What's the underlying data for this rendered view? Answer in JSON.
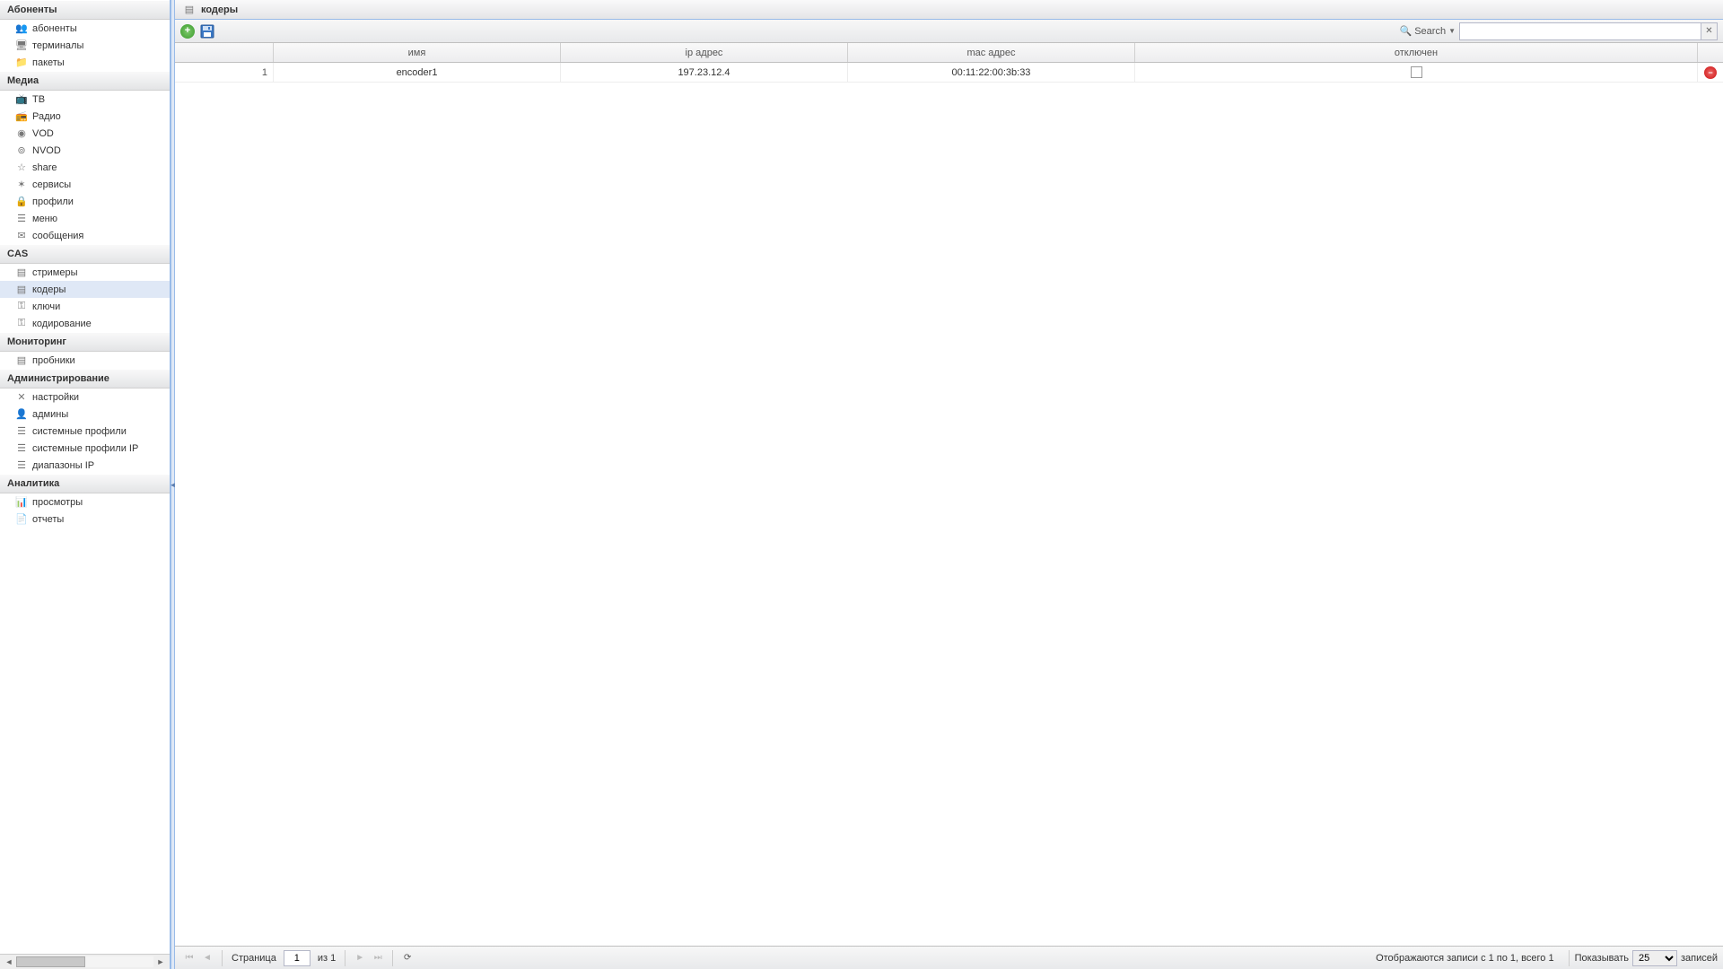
{
  "sidebar": {
    "groups": [
      {
        "title": "Абоненты",
        "items": [
          {
            "label": "абоненты",
            "icon": "👥"
          },
          {
            "label": "терминалы",
            "icon": "🖥"
          },
          {
            "label": "пакеты",
            "icon": "📁"
          }
        ]
      },
      {
        "title": "Медиа",
        "items": [
          {
            "label": "ТВ",
            "icon": "📺"
          },
          {
            "label": "Радио",
            "icon": "📻"
          },
          {
            "label": "VOD",
            "icon": "◉"
          },
          {
            "label": "NVOD",
            "icon": "⊚"
          },
          {
            "label": "share",
            "icon": "☆"
          },
          {
            "label": "сервисы",
            "icon": "✶"
          },
          {
            "label": "профили",
            "icon": "🔒"
          },
          {
            "label": "меню",
            "icon": "☰"
          },
          {
            "label": "сообщения",
            "icon": "✉"
          }
        ]
      },
      {
        "title": "CAS",
        "items": [
          {
            "label": "стримеры",
            "icon": "▤"
          },
          {
            "label": "кодеры",
            "icon": "▤",
            "selected": true
          },
          {
            "label": "ключи",
            "icon": "⚿"
          },
          {
            "label": "кодирование",
            "icon": "⚿"
          }
        ]
      },
      {
        "title": "Мониторинг",
        "items": [
          {
            "label": "пробники",
            "icon": "▤"
          }
        ]
      },
      {
        "title": "Администрирование",
        "items": [
          {
            "label": "настройки",
            "icon": "✕"
          },
          {
            "label": "админы",
            "icon": "👤"
          },
          {
            "label": "системные профили",
            "icon": "☰"
          },
          {
            "label": "системные профили IP",
            "icon": "☰"
          },
          {
            "label": "диапазоны IP",
            "icon": "☰"
          }
        ]
      },
      {
        "title": "Аналитика",
        "items": [
          {
            "label": "просмотры",
            "icon": "📊"
          },
          {
            "label": "отчеты",
            "icon": "📄"
          }
        ]
      }
    ]
  },
  "panel": {
    "title": "кодеры"
  },
  "toolbar": {
    "search_label": "Search"
  },
  "grid": {
    "columns": {
      "num": "",
      "name": "имя",
      "ip": "ip адрес",
      "mac": "mac адрес",
      "disabled": "отключен"
    },
    "rows": [
      {
        "num": "1",
        "name": "encoder1",
        "ip": "197.23.12.4",
        "mac": "00:11:22:00:3b:33",
        "disabled": false
      }
    ]
  },
  "paging": {
    "page_label": "Страница",
    "page": "1",
    "of_label": "из 1",
    "status": "Отображаются записи с 1 по 1, всего 1",
    "show_label": "Показывать",
    "page_size": "25",
    "records_label": "записей"
  }
}
